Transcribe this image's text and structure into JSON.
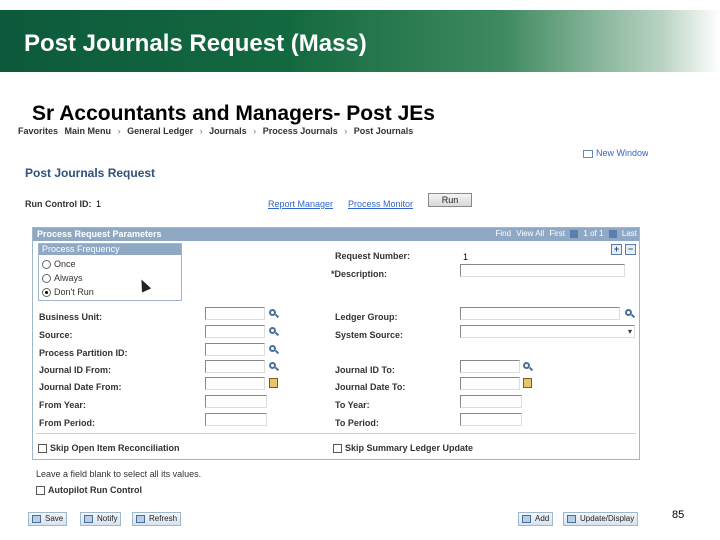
{
  "slide": {
    "title": "Post Journals Request (Mass)",
    "subtitle": "Sr Accountants and Managers- Post JEs",
    "page_number": "85",
    "accent_color": "#13693f"
  },
  "breadcrumb": [
    "Favorites",
    "Main Menu",
    "General Ledger",
    "Journals",
    "Process Journals",
    "Post Journals"
  ],
  "header": {
    "new_window": "New Window",
    "page_title": "Post Journals Request",
    "run_control_label": "Run Control ID:",
    "run_control_value": "1",
    "report_manager": "Report Manager",
    "process_monitor": "Process Monitor",
    "run_button": "Run"
  },
  "params": {
    "title": "Process Request Parameters",
    "find": "Find",
    "view_all": "View All",
    "first": "First",
    "count": "1 of 1",
    "last": "Last",
    "frequency": {
      "title": "Process Frequency",
      "options": [
        "Once",
        "Always",
        "Don't Run"
      ],
      "selected": "Don't Run"
    },
    "request_number_label": "Request Number:",
    "request_number_value": "1",
    "description_label": "*Description:",
    "left_fields": [
      "Business Unit:",
      "Source:",
      "Process Partition ID:",
      "Journal ID From:",
      "Journal Date From:",
      "From Year:",
      "From Period:"
    ],
    "right_fields": [
      "Ledger Group:",
      "System Source:",
      "Journal ID To:",
      "Journal Date To:",
      "To Year:",
      "To Period:"
    ],
    "skip_open_item": "Skip Open Item Reconciliation",
    "skip_summary": "Skip Summary Ledger Update"
  },
  "footer_note": "Leave a field blank to select all its values.",
  "autopilot": "Autopilot Run Control",
  "toolbar": {
    "save": "Save",
    "notify": "Notify",
    "refresh": "Refresh",
    "add": "Add",
    "update_display": "Update/Display"
  },
  "icons": [
    "new-window-icon",
    "plus-icon",
    "minus-icon",
    "lookup-icon",
    "calendar-icon",
    "save-icon",
    "notify-icon",
    "refresh-icon",
    "add-icon",
    "update-display-icon"
  ]
}
